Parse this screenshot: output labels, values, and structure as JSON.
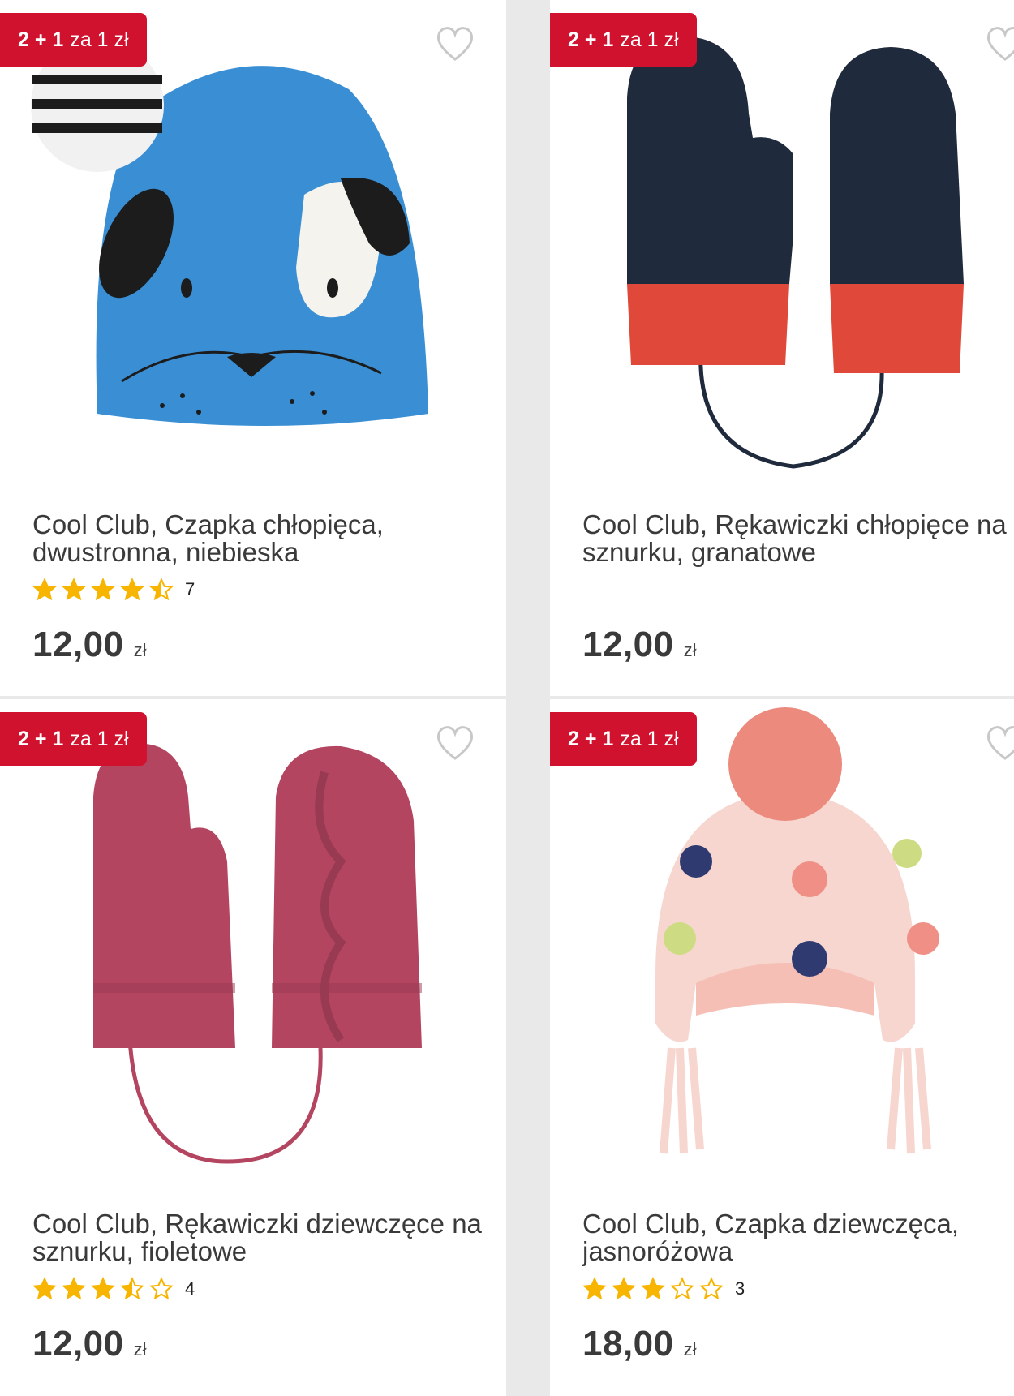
{
  "products": [
    {
      "badge_bold": "2 + 1",
      "badge_rest": "za 1 zł",
      "title": "Cool Club, Czapka chłopięca, dwustronna, niebieska",
      "rating": 4.5,
      "review_count": "7",
      "price": "12,00",
      "currency": "zł",
      "image_icon": "blue-dog-beanie-image"
    },
    {
      "badge_bold": "2 + 1",
      "badge_rest": "za 1 zł",
      "title": "Cool Club, Rękawiczki chłopięce na sznurku, granatowe",
      "rating": null,
      "review_count": "",
      "price": "12,00",
      "currency": "zł",
      "image_icon": "navy-mittens-image"
    },
    {
      "badge_bold": "2 + 1",
      "badge_rest": "za 1 zł",
      "title": "Cool Club, Rękawiczki dziewczęce na sznurku, fioletowe",
      "rating": 3.5,
      "review_count": "4",
      "price": "12,00",
      "currency": "zł",
      "image_icon": "purple-mittens-image"
    },
    {
      "badge_bold": "2 + 1",
      "badge_rest": "za 1 zł",
      "title": "Cool Club, Czapka dziewczęca, jasnoróżowa",
      "rating": 3,
      "review_count": "3",
      "price": "18,00",
      "currency": "zł",
      "image_icon": "pink-pompom-hat-image"
    }
  ],
  "colors": {
    "badge": "#d0122e",
    "star": "#f7b500",
    "heart": "#c8c8c8"
  }
}
